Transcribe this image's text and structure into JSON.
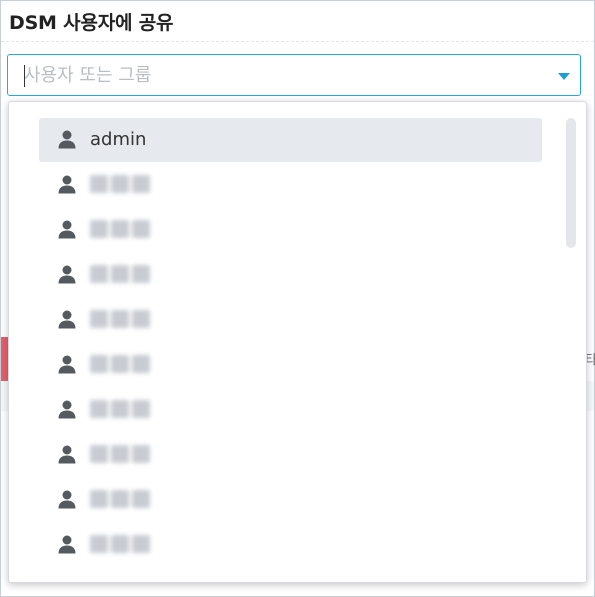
{
  "dialog": {
    "title": "DSM 사용자에 공유"
  },
  "search": {
    "placeholder": "사용자 또는 그룹",
    "value": ""
  },
  "users": [
    {
      "label": "admin",
      "blurred": false,
      "selected": true
    },
    {
      "label": "",
      "blurred": true,
      "selected": false
    },
    {
      "label": "",
      "blurred": true,
      "selected": false
    },
    {
      "label": "",
      "blurred": true,
      "selected": false
    },
    {
      "label": "",
      "blurred": true,
      "selected": false
    },
    {
      "label": "",
      "blurred": true,
      "selected": false
    },
    {
      "label": "",
      "blurred": true,
      "selected": false
    },
    {
      "label": "",
      "blurred": true,
      "selected": false
    },
    {
      "label": "",
      "blurred": true,
      "selected": false
    },
    {
      "label": "",
      "blurred": true,
      "selected": false
    }
  ],
  "icons": {
    "user": "user-icon",
    "dropdown": "chevron-down-icon"
  },
  "colors": {
    "accent": "#1f9fd0",
    "selected_bg": "#e6e9ee",
    "icon": "#555a60"
  },
  "background": {
    "right_text": "타"
  }
}
